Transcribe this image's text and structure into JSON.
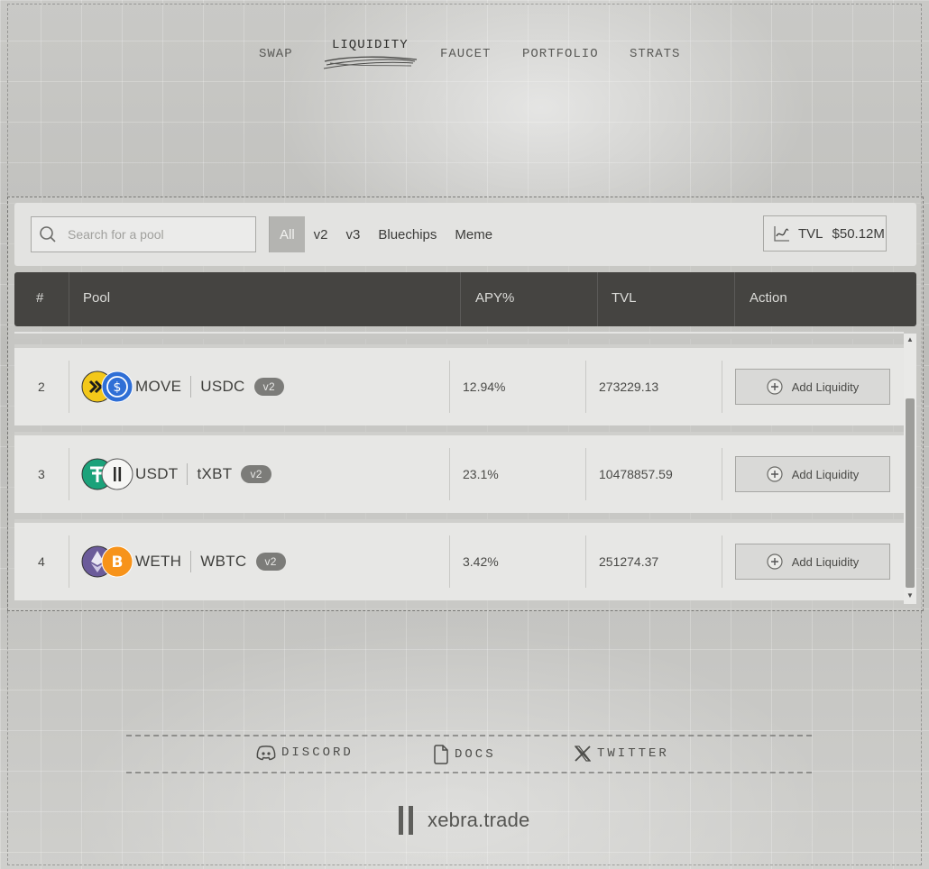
{
  "nav": {
    "items": [
      {
        "label": "SWAP",
        "active": false
      },
      {
        "label": "LIQUIDITY",
        "active": true
      },
      {
        "label": "FAUCET",
        "active": false
      },
      {
        "label": "PORTFOLIO",
        "active": false
      },
      {
        "label": "STRATS",
        "active": false
      }
    ]
  },
  "search": {
    "placeholder": "Search for a pool",
    "value": ""
  },
  "filters": [
    {
      "label": "All",
      "active": true
    },
    {
      "label": "v2",
      "active": false
    },
    {
      "label": "v3",
      "active": false
    },
    {
      "label": "Bluechips",
      "active": false
    },
    {
      "label": "Meme",
      "active": false
    }
  ],
  "tvl_summary": {
    "label": "TVL",
    "value": "$50.12M",
    "icon": "chart-line-icon"
  },
  "table": {
    "headers": {
      "index": "#",
      "pool": "Pool",
      "apy": "APY%",
      "tvl": "TVL",
      "action": "Action"
    },
    "rows": [
      {
        "index": "2",
        "token_a": "MOVE",
        "token_b": "USDC",
        "version": "v2",
        "apy": "12.94%",
        "tvl": "273229.13",
        "action": "Add Liquidity",
        "icon_a_color": "#f3c81a",
        "icon_b_color": "#2f6fd6"
      },
      {
        "index": "3",
        "token_a": "USDT",
        "token_b": "tXBT",
        "version": "v2",
        "apy": "23.1%",
        "tvl": "10478857.59",
        "action": "Add Liquidity",
        "icon_a_color": "#1ba27a",
        "icon_b_color": "#f6f6f4"
      },
      {
        "index": "4",
        "token_a": "WETH",
        "token_b": "WBTC",
        "version": "v2",
        "apy": "3.42%",
        "tvl": "251274.37",
        "action": "Add Liquidity",
        "icon_a_color": "#6b5b9a",
        "icon_b_color": "#f7931a"
      }
    ]
  },
  "footer": {
    "links": [
      {
        "label": "DISCORD",
        "icon": "discord-icon"
      },
      {
        "label": "DOCS",
        "icon": "document-icon"
      },
      {
        "label": "TWITTER",
        "icon": "x-icon"
      }
    ],
    "brand": "xebra.trade"
  },
  "colors": {
    "header_bg": "#454441",
    "active_filter": "#b4b4b1",
    "badge": "#7c7c79"
  }
}
